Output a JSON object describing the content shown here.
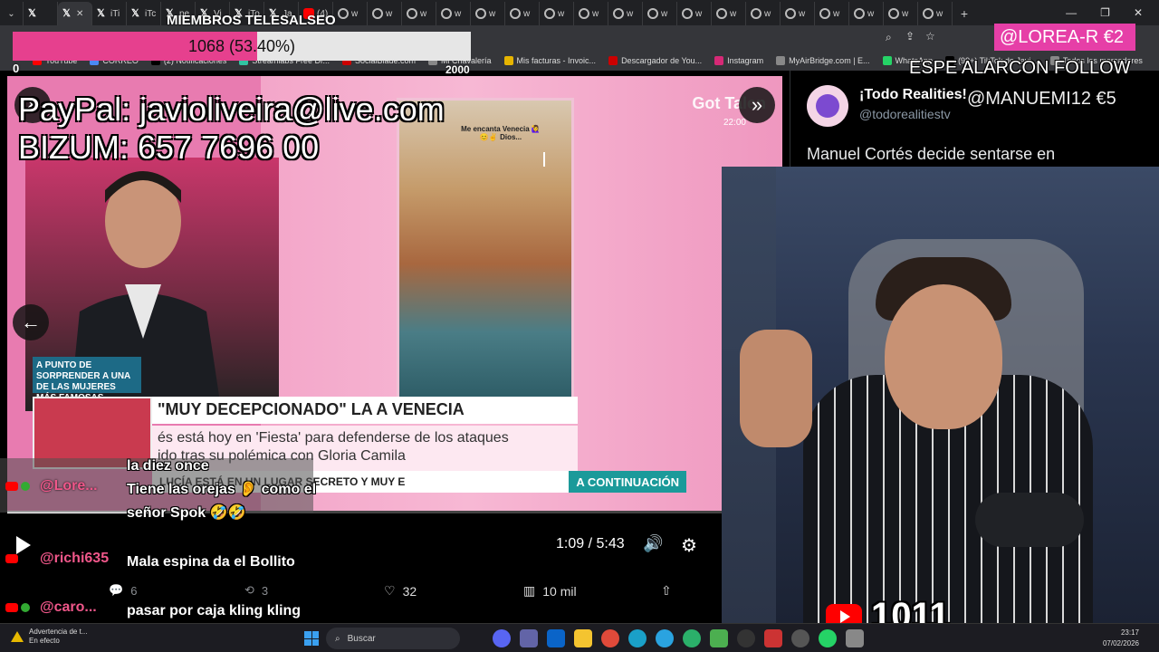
{
  "browser": {
    "tabs": [
      {
        "label": "",
        "icon": "x-icon",
        "active": false
      },
      {
        "label": "",
        "icon": "x-icon",
        "active": true
      },
      {
        "label": "iTi",
        "icon": "x-icon",
        "active": false
      },
      {
        "label": "iTc",
        "icon": "x-icon",
        "active": false
      },
      {
        "label": "pe",
        "icon": "x-icon",
        "active": false
      },
      {
        "label": "Vi",
        "icon": "x-icon",
        "active": false
      },
      {
        "label": "iTo",
        "icon": "x-icon",
        "active": false
      },
      {
        "label": "Ja",
        "icon": "x-icon",
        "active": false
      },
      {
        "label": "(4)",
        "icon": "youtube-icon",
        "active": false
      },
      {
        "label": "w",
        "icon": "globe-icon",
        "active": false
      }
    ],
    "bookmarks": [
      "YouTube",
      "CORREO",
      "(2) Notificaciones",
      "Streamlabs Free Dr...",
      "SocialBlade.com",
      "Mi Chavalería",
      "Mis facturas - Invoic...",
      "Descargador de You...",
      "Instagram",
      "MyAirBridge.com | E...",
      "WhatsApp",
      "(99+) TikTok de Javi...",
      "Todos los marcadores"
    ]
  },
  "overlay": {
    "members_title": "MIEMBROS TELESALSEO",
    "members_value": "1068 (53.40%)",
    "members_fraction": 0.534,
    "members_min": "0",
    "members_max": "2000",
    "alert_user": "@LOREA-R  €2",
    "follow_text": "ESPE ALARCON  FOLLOW",
    "donation_text": "@MANUEMI12  €5",
    "paypal_line": "PayPal: javioliveira@live.com",
    "bizum_line": "BIZUM: 657 7696 00",
    "youtube_count": "1011"
  },
  "video": {
    "channel_logo": "Got Talen",
    "clock": "22:00",
    "venice_caption": "Me encanta Venecia 🙋‍♀️😊✌️ Dios...",
    "tag_left": "A PUNTO DE SORPRENDER A UNA DE LAS MUJERES MÁS FAMOSAS",
    "banner": "\"MUY DECEPCIONADO\" LA A VENECIA",
    "subbanner_line1": "és está hoy en 'Fiesta' para defenderse de los ataques",
    "subbanner_line2": "ido tras su polémica con Gloria Camila",
    "ticker": "LUCÍA ESTÁ EN UN LUGAR SECRETO Y MUY E",
    "ticker_cta": "A CONTINUACIÓN",
    "time": "1:09 / 5:43",
    "progress_fraction": 0.2
  },
  "tweet": {
    "name": "¡Todo Realities!",
    "handle": "@todorealitiestv",
    "text": "Manuel Cortés decide sentarse en",
    "replies": "6",
    "retweets": "3",
    "likes": "32",
    "views": "10 mil"
  },
  "chat": [
    {
      "user": "",
      "msg": "la diez once"
    },
    {
      "user": "@Lore...",
      "msg": "Tiene las orejas 👂 como el señor Spok 🤣🤣"
    },
    {
      "user": "@richi635",
      "msg": "Mala espina da el Bollito"
    },
    {
      "user": "@caro...",
      "msg": "pasar por caja kling kling"
    }
  ],
  "taskbar": {
    "warning_title": "Advertencia de t...",
    "warning_sub": "En efecto",
    "search_placeholder": "Buscar",
    "time": "23:17",
    "date": "07/02/2026"
  }
}
